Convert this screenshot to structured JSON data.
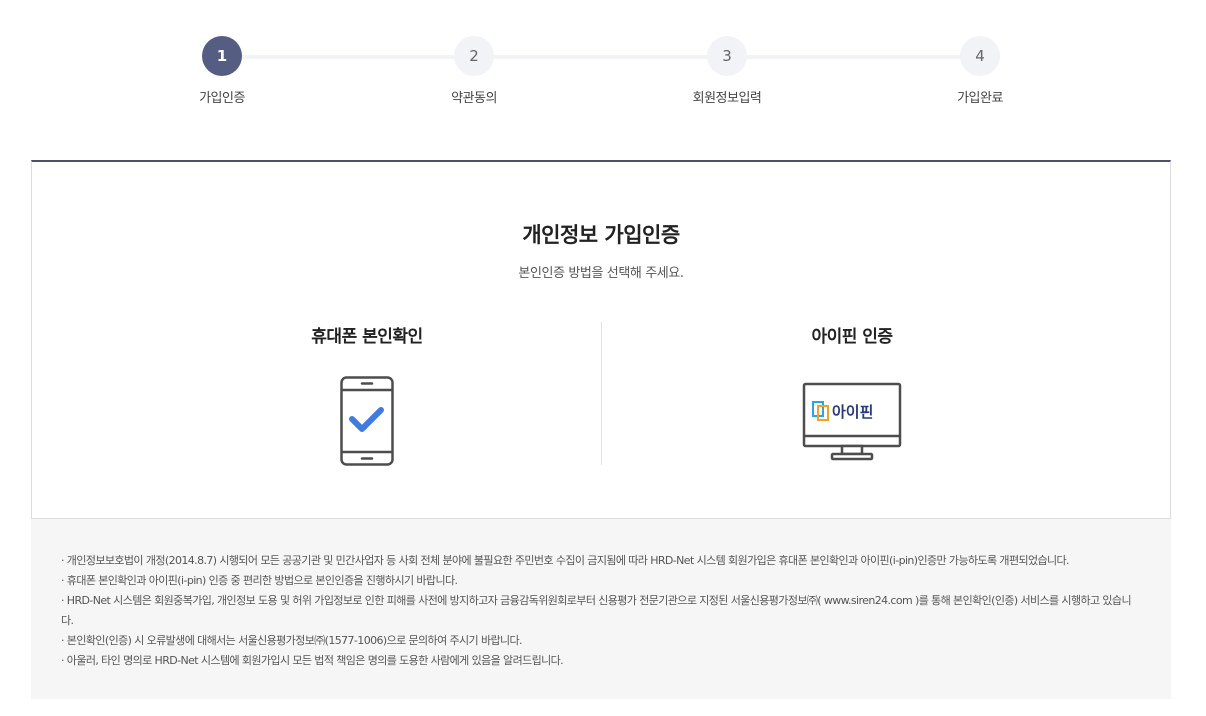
{
  "stepper": {
    "steps": [
      {
        "number": "1",
        "label": "가입인증"
      },
      {
        "number": "2",
        "label": "약관동의"
      },
      {
        "number": "3",
        "label": "회원정보입력"
      },
      {
        "number": "4",
        "label": "가입완료"
      }
    ],
    "active_index": 0
  },
  "certification": {
    "title": "개인정보 가입인증",
    "subtitle": "본인인증 방법을 선택해 주세요.",
    "methods": {
      "phone": {
        "title": "휴대폰 본인확인",
        "icon": "smartphone-check-icon"
      },
      "ipin": {
        "title": "아이핀 인증",
        "icon": "monitor-ipin-icon",
        "logo_text": "아이핀"
      }
    }
  },
  "notice": {
    "items": [
      "· 개인정보보호법이 개정(2014.8.7) 시행되어 모든 공공기관 및 민간사업자 등 사회 전체 분야에 불필요한 주민번호 수집이 금지됨에 따라 HRD-Net 시스템 회원가입은 휴대폰 본인확인과 아이핀(i-pin)인증만 가능하도록 개편되었습니다.",
      "· 휴대폰 본인확인과 아이핀(i-pin) 인증 중 편리한 방법으로 본인인증을 진행하시기 바랍니다.",
      "· HRD-Net 시스템은 회원중복가입, 개인정보 도용 및 허위 가입정보로 인한 피해를 사전에 방지하고자 금융감독위원회로부터 신용평가 전문기관으로 지정된 서울신용평가정보㈜( www.siren24.com )를 통해 본인확인(인증) 서비스를 시행하고 있습니다.",
      "· 본인확인(인증) 시 오류발생에 대해서는 서울신용평가정보㈜(1577-1006)으로 문의하여 주시기 바랍니다.",
      "· 아울러, 타인 명의로 HRD-Net 시스템에 회원가입시 모든 법적 책임은 명의를 도용한 사람에게 있음을 알려드립니다."
    ]
  },
  "colors": {
    "active_step": "#565d83",
    "inactive_step": "#f2f3f6",
    "box_top_border": "#4a5269",
    "check_blue": "#3f7be0",
    "notice_bg": "#f6f6f6"
  }
}
